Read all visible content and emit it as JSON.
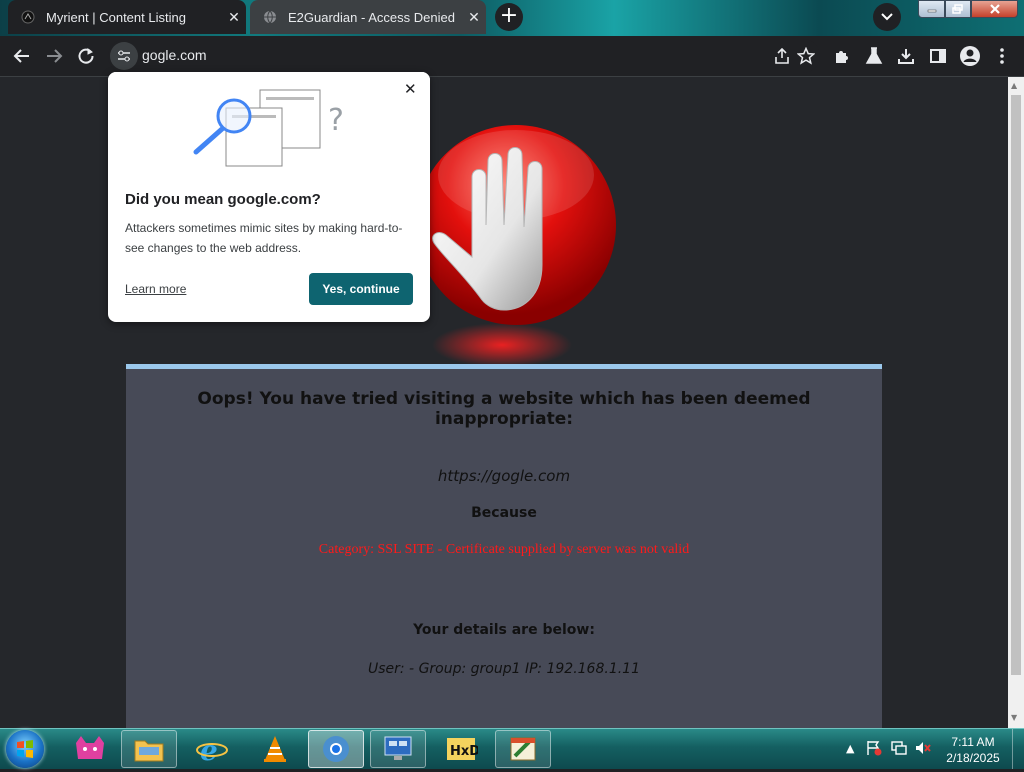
{
  "tabs": [
    {
      "title": "Myrient | Content Listing",
      "active": true
    },
    {
      "title": "E2Guardian - Access Denied",
      "active": false
    }
  ],
  "omnibox": {
    "url": "gogle.com"
  },
  "popup": {
    "title": "Did you mean google.com?",
    "body": "Attackers sometimes mimic sites by making hard-to-see changes to the web address.",
    "learn_more": "Learn more",
    "continue_label": "Yes, continue",
    "accent": "#0e6470"
  },
  "block_page": {
    "headline": "Oops! You have tried visiting a website which has been deemed inappropriate:",
    "blocked_url": "https://gogle.com",
    "because_label": "Because",
    "reason": "Category: SSL SITE - Certificate supplied by server was not valid",
    "details_heading": "Your details are below:",
    "details": "User: -   Group: group1   IP: 192.168.1.11"
  },
  "taskbar": {
    "time": "7:11 AM",
    "date": "2/18/2025"
  },
  "colors": {
    "reason": "#ff1a1a",
    "panel": "#474a57",
    "panel_border": "#9bc8ec"
  }
}
